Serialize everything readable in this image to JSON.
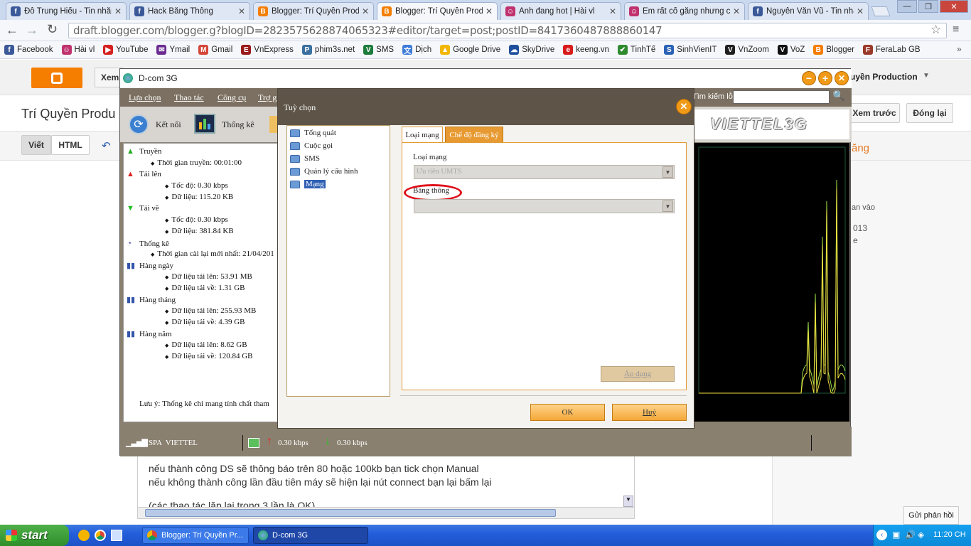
{
  "browser": {
    "tabs": [
      {
        "title": "Đỗ Trung Hiếu - Tin nhắn",
        "icon": "facebook-icon",
        "color": "#3b5998",
        "glyph": "f",
        "active": false
      },
      {
        "title": "Hack Băng Thông",
        "icon": "facebook-icon",
        "color": "#3b5998",
        "glyph": "f",
        "active": false
      },
      {
        "title": "Blogger: Trí Quyền Produ",
        "icon": "blogger-icon",
        "color": "#f57d00",
        "glyph": "B",
        "active": false
      },
      {
        "title": "Blogger: Trí Quyền Produ",
        "icon": "blogger-icon",
        "color": "#f57d00",
        "glyph": "B",
        "active": true
      },
      {
        "title": "Ảnh đang hot | Hài vl",
        "icon": "haivl-icon",
        "color": "#c0326e",
        "glyph": "☺",
        "active": false
      },
      {
        "title": "Em rất cố gắng nhưng c",
        "icon": "haivl-icon",
        "color": "#c0326e",
        "glyph": "☺",
        "active": false
      },
      {
        "title": "Nguyễn Văn Vũ - Tin nhắ",
        "icon": "facebook-icon",
        "color": "#3b5998",
        "glyph": "f",
        "active": false
      }
    ],
    "url": "draft.blogger.com/blogger.g?blogID=2823575628874065323#editor/target=post;postID=8417360487888860147",
    "bookmarks": [
      {
        "label": "Facebook",
        "color": "#3b5998",
        "glyph": "f"
      },
      {
        "label": "Hài vl",
        "color": "#c0326e",
        "glyph": "☺"
      },
      {
        "label": "YouTube",
        "color": "#d62020",
        "glyph": "▶"
      },
      {
        "label": "Ymail",
        "color": "#6b2c91",
        "glyph": "✉"
      },
      {
        "label": "Gmail",
        "color": "#d44638",
        "glyph": "M"
      },
      {
        "label": "VnExpress",
        "color": "#9a1b1b",
        "glyph": "E"
      },
      {
        "label": "phim3s.net",
        "color": "#3a6f9e",
        "glyph": "P"
      },
      {
        "label": "SMS",
        "color": "#1d7c3c",
        "glyph": "V"
      },
      {
        "label": "Dịch",
        "color": "#3d7bd9",
        "glyph": "文"
      },
      {
        "label": "Google Drive",
        "color": "#f2b705",
        "glyph": "▲"
      },
      {
        "label": "SkyDrive",
        "color": "#1f4f9c",
        "glyph": "☁"
      },
      {
        "label": "keeng.vn",
        "color": "#d81b1b",
        "glyph": "e"
      },
      {
        "label": "TinhTế",
        "color": "#2f8a2f",
        "glyph": "✔"
      },
      {
        "label": "SinhVienIT",
        "color": "#2b62b5",
        "glyph": "S"
      },
      {
        "label": "VnZoom",
        "color": "#1f1f1f",
        "glyph": "V"
      },
      {
        "label": "VoZ",
        "color": "#111111",
        "glyph": "V"
      },
      {
        "label": "Blogger",
        "color": "#f57d00",
        "glyph": "B"
      },
      {
        "label": "FeraLab GB",
        "color": "#9b3a2a",
        "glyph": "F"
      }
    ]
  },
  "blogger": {
    "view_label": "Xem",
    "title": "Trí Quyền Produ",
    "account": "uyền Production",
    "write_tab": "Viết",
    "html_tab": "HTML",
    "preview_button": "Xem trước",
    "close_button": "Đóng lại",
    "side_heading": "ăng",
    "side_text_1": "an vào",
    "side_text_2": "013",
    "side_text_3": "e",
    "feedback_button": "Gửi phản hồi",
    "editor_line_1": "nếu thành công DS sẽ thông báo trên 80 hoặc 100kb bạn tick chọn Manual",
    "editor_line_2": "nếu không thành công lần đầu tiên máy sẽ hiện lại nút connect bạn lại bấm lại",
    "editor_line_3": "(các thao tác lặp lại trong 3 lần là OK)"
  },
  "dcom": {
    "title": "D-com 3G",
    "menu": [
      "Lựa chọn",
      "Thao tác",
      "Công cụ",
      "Trợ g"
    ],
    "search_label": "Tìm kiếm lỗi",
    "connect_label": "Kết nối",
    "stats_label": "Thống kê",
    "brand": "VIETTEL3G",
    "tree": {
      "transfer": "Truyền",
      "transfer_time": "Thời gian truyền: 00:01:00",
      "upload": "Tải lên",
      "upload_speed": "Tốc độ: 0.30 kbps",
      "upload_data": "Dữ liệu: 115.20 KB",
      "download": "Tải về",
      "download_speed": "Tốc độ: 0.30 kbps",
      "download_data": "Dữ liệu: 381.84 KB",
      "stats": "Thống kê",
      "reset_time": "Thời gian cài lại mới nhất: 21/04/201",
      "daily": "Hàng ngày",
      "daily_up": "Dữ liệu tải lên: 53.91 MB",
      "daily_down": "Dữ liệu tải về: 1.31 GB",
      "monthly": "Hàng tháng",
      "monthly_up": "Dữ liệu tải lên: 255.93 MB",
      "monthly_down": "Dữ liệu tải về: 4.39 GB",
      "yearly": "Hàng năm",
      "yearly_up": "Dữ liệu tải lên: 8.62 GB",
      "yearly_down": "Dữ liệu tải về: 120.84 GB",
      "note": "Lưu ý: Thống kê chỉ mang tính chất tham"
    },
    "status": {
      "network": "HSPA  VIETTEL",
      "up": "0.30 kbps",
      "down": "0.30 kbps"
    }
  },
  "dialog": {
    "title": "Tuỳ chọn",
    "nav": [
      {
        "label": "Tổng quát",
        "selected": false
      },
      {
        "label": "Cuộc gọi",
        "selected": false
      },
      {
        "label": "SMS",
        "selected": false
      },
      {
        "label": "Quản lý cấu hình",
        "selected": false
      },
      {
        "label": "Mạng",
        "selected": true
      }
    ],
    "tab_network_type": "Loại mạng",
    "tab_registration": "Chế độ đăng ký",
    "network_type_label": "Loại mạng",
    "network_type_value": "Ưu tiên UMTS",
    "bandwidth_label": "Băng thông",
    "bandwidth_value": "",
    "apply_button": "Áp dụng",
    "ok_button": "OK",
    "cancel_button": "Huỷ"
  },
  "taskbar": {
    "start": "start",
    "items": [
      {
        "label": "Blogger: Trí Quyền Pr...",
        "active": false
      },
      {
        "label": "D-com 3G",
        "active": true
      }
    ],
    "clock": "11:20 CH"
  }
}
